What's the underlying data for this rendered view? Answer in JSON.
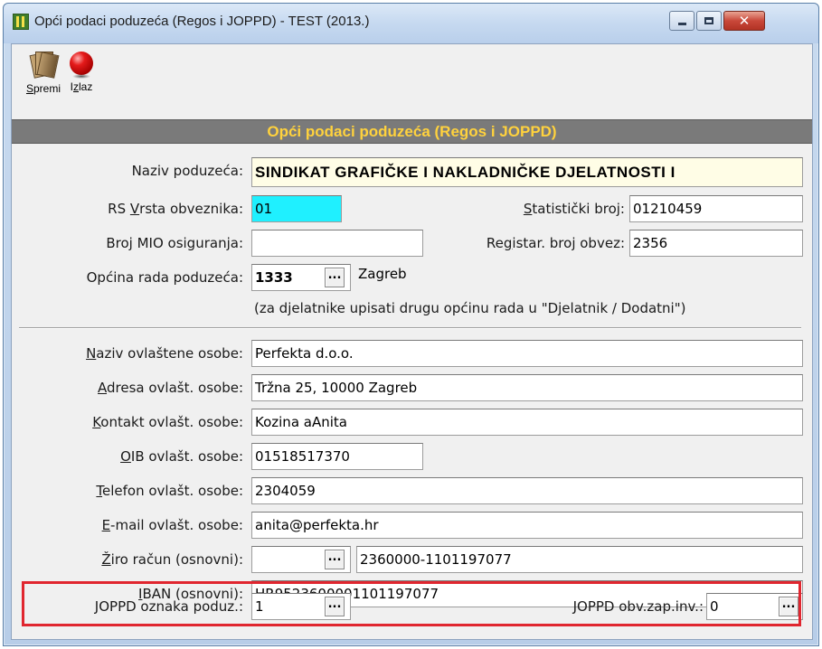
{
  "window": {
    "title": "Opći podaci poduzeća (Regos i JOPPD) - TEST (2013.)",
    "close_glyph": "✕"
  },
  "toolbar": {
    "save_label_accel": "S",
    "save_label_rest": "premi",
    "exit_label_first": "I",
    "exit_label_accel": "z",
    "exit_label_rest": "laz"
  },
  "header": {
    "title": "Opći podaci poduzeća (Regos i JOPPD)"
  },
  "form": {
    "naziv_label": "Naziv poduzeća:",
    "naziv_value": "SINDIKAT GRAFIČKE I NAKLADNIČKE DJELATNOSTI I",
    "rs_label_pre": "RS ",
    "rs_label_accel": "V",
    "rs_label_post": "rsta obveznika:",
    "rs_value": "01",
    "stat_label_accel": "S",
    "stat_label_post": "tatistički broj:",
    "stat_value": "01210459",
    "mio_label": "Broj MIO osiguranja:",
    "mio_value": "",
    "reg_label_pre": "Re",
    "reg_label_accel": "g",
    "reg_label_post": "istar. broj obvez:",
    "reg_value": "2356",
    "opcina_label": "Općina rada poduzeća:",
    "opcina_code": "1333",
    "opcina_name": "Zagreb",
    "hint": "(za djelatnike upisati drugu općinu rada u  \"Djelatnik / Dodatni\")",
    "ovl_naziv_accel": "N",
    "ovl_naziv_post": "aziv ovlaštene osobe:",
    "ovl_naziv_value": "Perfekta d.o.o.",
    "ovl_adresa_accel": "A",
    "ovl_adresa_post": "dresa ovlašt. osobe:",
    "ovl_adresa_value": "Tržna 25, 10000 Zagreb",
    "ovl_kontakt_accel": "K",
    "ovl_kontakt_post": "ontakt ovlašt. osobe:",
    "ovl_kontakt_value": "Kozina aAnita",
    "ovl_oib_accel": "O",
    "ovl_oib_post": "IB ovlašt. osobe:",
    "ovl_oib_value": "01518517370",
    "ovl_tel_accel": "T",
    "ovl_tel_post": "elefon ovlašt. osobe:",
    "ovl_tel_value": "2304059",
    "ovl_email_accel": "E",
    "ovl_email_post": "-mail ovlašt. osobe:",
    "ovl_email_value": "anita@perfekta.hr",
    "ziro_accel": "Ž",
    "ziro_post": "iro račun (osnovni):",
    "ziro_code": "",
    "ziro_value": "2360000-1101197077",
    "iban_accel": "I",
    "iban_post": "BAN (osnovni):",
    "iban_value": "HR9523600001101197077",
    "joppd_oznaka_label": "JOPPD oznaka poduz.:",
    "joppd_oznaka_value": "1",
    "joppd_obv_label": "JOPPD obv.zap.inv.:",
    "joppd_obv_value": "0",
    "dots": "..."
  },
  "colors": {
    "header_bg": "#7a7a7a",
    "header_text": "#ffd23d",
    "highlight_cyan": "#1ff0ff",
    "highlight_yellow": "#fffde6",
    "annotation_red": "#e0262f"
  }
}
